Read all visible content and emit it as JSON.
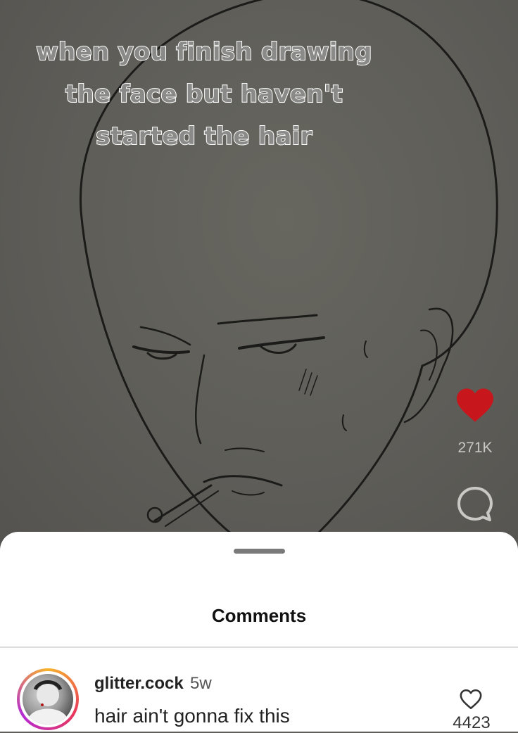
{
  "video": {
    "caption_lines": [
      "when you finish drawing",
      "the face but haven't",
      "started the hair"
    ],
    "like_count": "271K",
    "liked": true
  },
  "comments_sheet": {
    "title": "Comments",
    "comments": [
      {
        "username": "glitter.cock",
        "time": "5w",
        "text": "hair ain't gonna fix this",
        "like_count": "4423"
      }
    ]
  },
  "icons": {
    "like": "heart-icon",
    "comment": "comment-bubble-icon",
    "comment_like": "heart-outline-icon"
  },
  "colors": {
    "heart": "#c8161d",
    "story_ring": [
      "#f7b32b",
      "#e8365d",
      "#b52bd6"
    ]
  }
}
